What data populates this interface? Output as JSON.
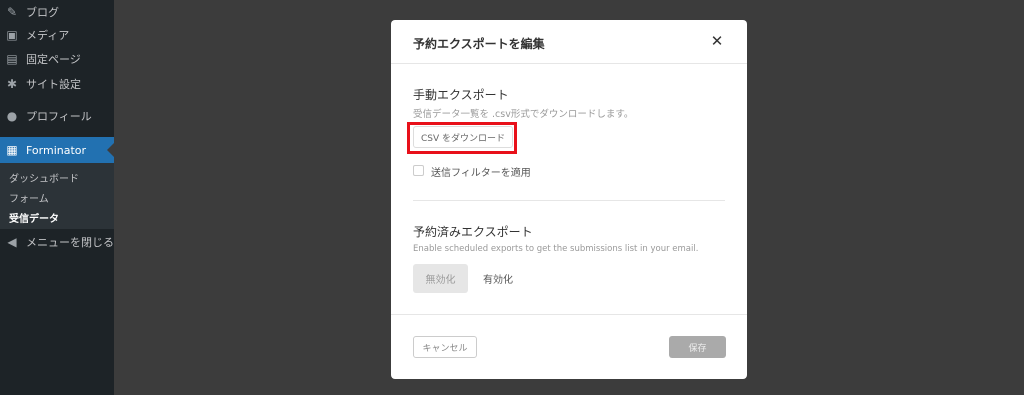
{
  "sidebar": {
    "items": [
      {
        "label": "ブログ",
        "icon": "pin-icon",
        "glyph": "✎"
      },
      {
        "label": "メディア",
        "icon": "media-icon",
        "glyph": "▣"
      },
      {
        "label": "固定ページ",
        "icon": "page-icon",
        "glyph": "▤"
      },
      {
        "label": "サイト設定",
        "icon": "settings-icon",
        "glyph": "✱"
      },
      {
        "label": "プロフィール",
        "icon": "user-icon",
        "glyph": "●"
      },
      {
        "label": "Forminator",
        "icon": "forminator-icon",
        "glyph": "▦"
      }
    ],
    "submenu": [
      "ダッシュボード",
      "フォーム",
      "受信データ"
    ],
    "collapse": {
      "label": "メニューを閉じる",
      "glyph": "◀"
    }
  },
  "modal": {
    "title": "予約エクスポートを編集",
    "close_glyph": "✕",
    "manual": {
      "title": "手動エクスポート",
      "description": "受信データ一覧を .csv形式でダウンロードします。",
      "csv_button": "CSV をダウンロード",
      "filter_label": "送信フィルターを適用"
    },
    "scheduled": {
      "title": "予約済みエクスポート",
      "description": "Enable scheduled exports to get the submissions list in your email.",
      "disable_label": "無効化",
      "enable_label": "有効化"
    },
    "footer": {
      "cancel_label": "キャンセル",
      "save_label": "保存"
    }
  },
  "colors": {
    "sidebar_bg": "#1d2327",
    "active_bg": "#2271b1",
    "highlight": "#e8101a",
    "overlay": "#3c3c3c"
  }
}
